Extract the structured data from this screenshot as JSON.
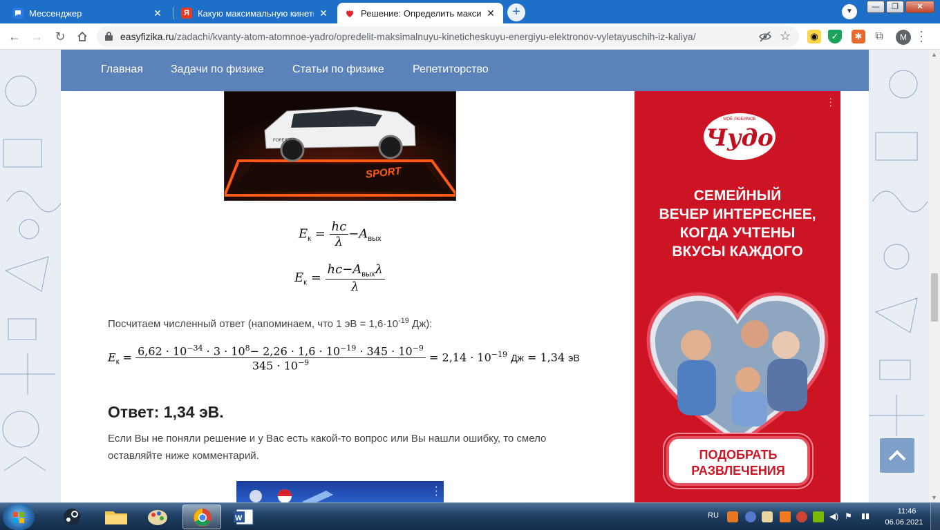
{
  "browser": {
    "tabs": [
      {
        "title": "Мессенджер",
        "favicon_color": "#2a7ae2",
        "favicon_glyph": "",
        "active": false
      },
      {
        "title": "Какую максимальную кинетиче",
        "favicon_color": "#e83a25",
        "favicon_glyph": "Я",
        "active": false
      },
      {
        "title": "Решение: Определить максима",
        "favicon_color": "#ffffff",
        "favicon_glyph": "",
        "active": true
      }
    ],
    "new_tab_glyph": "+",
    "url_host": "easyfizika.ru",
    "url_path": "/zadachi/kvanty-atom-atomnoe-yadro/opredelit-maksimalnuyu-kineticheskuyu-energiyu-elektronov-vyletayuschih-iz-kaliya/",
    "profile_initial": "M",
    "accent_color": "#1e6fc8"
  },
  "site": {
    "nav": [
      "Главная",
      "Задачи по физике",
      "Статьи по физике",
      "Репетиторство"
    ],
    "nav_color": "#5b82b9"
  },
  "car_image": {
    "badge_text": "SPORT",
    "plate_text": "FORESTER"
  },
  "formulas": {
    "E": "E",
    "k": "к",
    "hc": "hc",
    "lambda": "λ",
    "A": "A",
    "vyh": "вых",
    "minus": "−",
    "equals": "=",
    "num_full": "6,62 · 10",
    "exp1": "−34",
    "num_b": " · 3 · 10",
    "exp2": "8",
    "num_c": "− 2,26 · 1,6 · 10",
    "exp3": "−19",
    "num_d": " · 345 · 10",
    "exp4": "−9",
    "den_a": "345 · 10",
    "den_exp": "−9",
    "res_a": "= 2,14 · 10",
    "res_exp": "−19",
    "unit_j": "Дж",
    "res_b": "= 1,34",
    "unit_ev": "эВ"
  },
  "text": {
    "calc_intro_a": "Посчитаем численный ответ (напоминаем, что 1 эВ = 1,6·10",
    "calc_intro_exp": "-19",
    "calc_intro_b": " Дж):",
    "answer": "Ответ: 1,34 эВ.",
    "outro": "Если Вы не поняли решение и у Вас есть какой-то вопрос или Вы нашли ошибку, то смело оставляйте ниже комментарий."
  },
  "ad": {
    "brand_small": "МОЁ ЛЮБИМОЕ",
    "brand": "Чудо",
    "headline": [
      "Семейный",
      "вечер интереснее,",
      "когда учтены",
      "вкусы каждого"
    ],
    "cta": [
      "ПОДОБРАТЬ",
      "РАЗВЛЕЧЕНИЯ"
    ],
    "color": "#cc1424"
  },
  "taskbar": {
    "lang": "RU",
    "time": "11:46",
    "date": "06.06.2021"
  }
}
